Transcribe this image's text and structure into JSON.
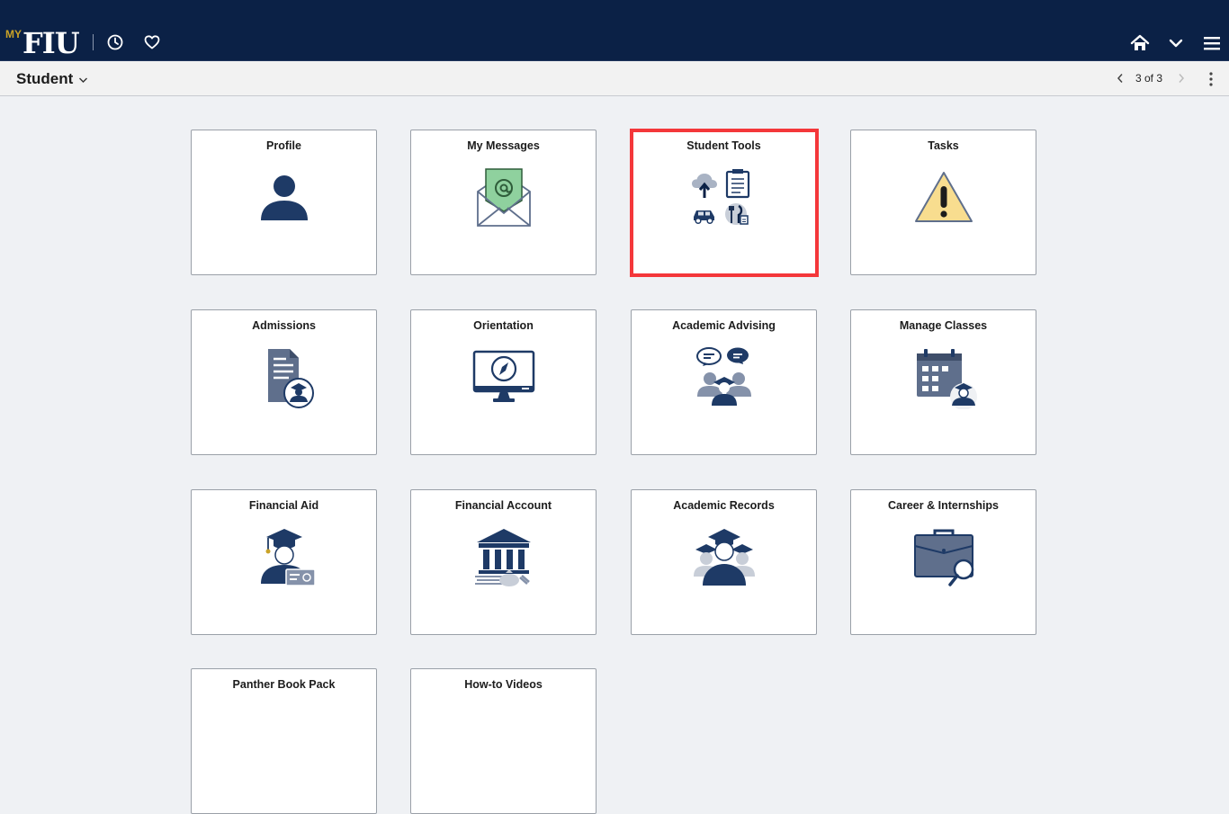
{
  "brand": {
    "my": "MY",
    "name": "FIU"
  },
  "header": {
    "title": "Student",
    "pager": "3 of 3"
  },
  "colors": {
    "navy": "#0b2146",
    "icon": "#1e3a66",
    "icon_light": "#5f6f8c",
    "highlight": "#f4373a"
  },
  "tiles": [
    {
      "label": "Profile",
      "icon": "person-icon"
    },
    {
      "label": "My Messages",
      "icon": "envelope-icon"
    },
    {
      "label": "Student Tools",
      "icon": "tools-icon"
    },
    {
      "label": "Tasks",
      "icon": "warning-icon"
    },
    {
      "label": "Admissions",
      "icon": "document-icon"
    },
    {
      "label": "Orientation",
      "icon": "monitor-compass-icon"
    },
    {
      "label": "Academic Advising",
      "icon": "advising-icon"
    },
    {
      "label": "Manage Classes",
      "icon": "calendar-icon"
    },
    {
      "label": "Financial Aid",
      "icon": "graduate-card-icon"
    },
    {
      "label": "Financial Account",
      "icon": "bank-icon"
    },
    {
      "label": "Academic Records",
      "icon": "graduates-icon"
    },
    {
      "label": "Career & Internships",
      "icon": "briefcase-icon"
    },
    {
      "label": "Panther Book Pack",
      "icon": "book-icon"
    },
    {
      "label": "How-to Videos",
      "icon": "video-icon"
    }
  ]
}
